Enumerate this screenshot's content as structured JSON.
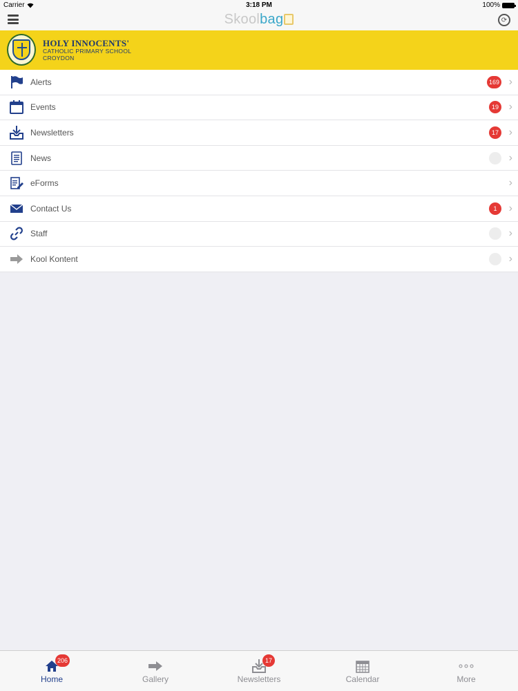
{
  "status_bar": {
    "carrier": "Carrier",
    "time": "3:18 PM",
    "battery": "100%"
  },
  "nav_bar": {
    "logo_part1": "Skool",
    "logo_part2": "bag",
    "menu_icon": "hamburger-icon",
    "sync_icon": "sync-icon"
  },
  "banner": {
    "school_name": "HOLY INNOCENTS'",
    "line2": "CATHOLIC PRIMARY SCHOOL",
    "line3": "CROYDON",
    "background": "#f4d31a"
  },
  "menu": {
    "items": [
      {
        "label": "Alerts",
        "icon": "flag-icon",
        "badge": "169"
      },
      {
        "label": "Events",
        "icon": "calendar-icon",
        "badge": "19"
      },
      {
        "label": "Newsletters",
        "icon": "inbox-download-icon",
        "badge": "17"
      },
      {
        "label": "News",
        "icon": "document-icon",
        "badge": ""
      },
      {
        "label": "eForms",
        "icon": "form-edit-icon",
        "badge": null
      },
      {
        "label": "Contact Us",
        "icon": "envelope-icon",
        "badge": "1"
      },
      {
        "label": "Staff",
        "icon": "link-icon",
        "badge": ""
      },
      {
        "label": "Kool Kontent",
        "icon": "arrow-right-icon",
        "badge": ""
      }
    ]
  },
  "tab_bar": {
    "tabs": [
      {
        "label": "Home",
        "icon": "home-icon",
        "badge": "206",
        "active": true
      },
      {
        "label": "Gallery",
        "icon": "arrow-right-icon",
        "badge": null,
        "active": false
      },
      {
        "label": "Newsletters",
        "icon": "inbox-download-icon",
        "badge": "17",
        "active": false
      },
      {
        "label": "Calendar",
        "icon": "calendar-icon",
        "badge": null,
        "active": false
      },
      {
        "label": "More",
        "icon": "more-dots-icon",
        "badge": null,
        "active": false
      }
    ]
  },
  "colors": {
    "accent_blue": "#22408c",
    "badge_red": "#e53935",
    "logo_blue": "#3aa7c9",
    "background": "#efeff4"
  }
}
